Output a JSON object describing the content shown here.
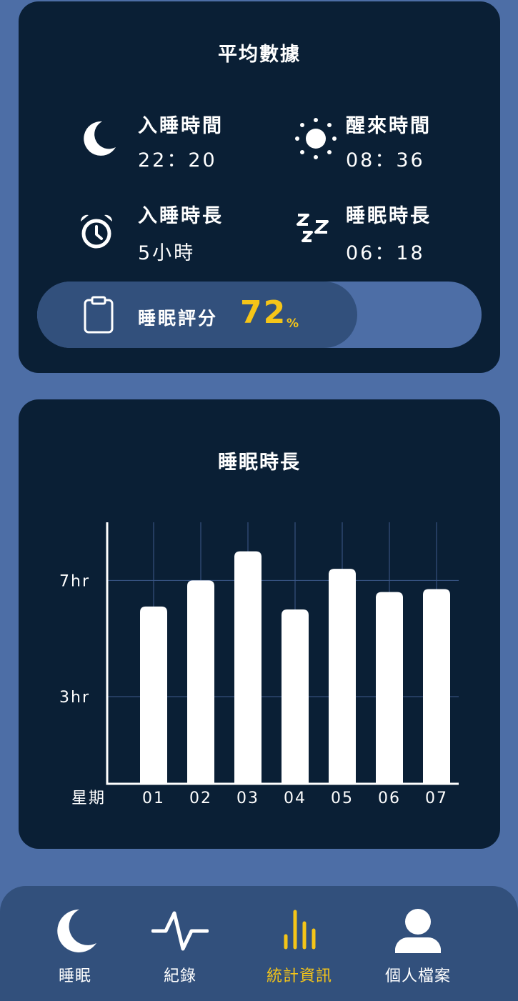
{
  "average": {
    "title": "平均數據",
    "sleep_time": {
      "label": "入睡時間",
      "value": "22：20",
      "icon": "moon-icon"
    },
    "wake_time": {
      "label": "醒來時間",
      "value": "08：36",
      "icon": "sun-icon"
    },
    "fall_asleep_duration": {
      "label": "入睡時長",
      "value": "5小時",
      "icon": "alarm-clock-icon"
    },
    "sleep_duration": {
      "label": "睡眠時長",
      "value": "06：18",
      "icon": "zzz-icon"
    },
    "score": {
      "label": "睡眠評分",
      "value": "72",
      "unit": "%",
      "percent": 72,
      "icon": "clipboard-icon"
    }
  },
  "chart_card": {
    "title": "睡眠時長"
  },
  "chart_data": {
    "type": "bar",
    "title": "睡眠時長",
    "xlabel": "星期",
    "ylabel": "",
    "categories": [
      "01",
      "02",
      "03",
      "04",
      "05",
      "06",
      "07"
    ],
    "values": [
      6.1,
      7.0,
      8.0,
      6.0,
      7.4,
      6.6,
      6.7
    ],
    "ytick_values": [
      3,
      7
    ],
    "ytick_labels": [
      "3hr",
      "7hr"
    ],
    "ylim": [
      0,
      9
    ],
    "grid": true,
    "bar_color": "#ffffff"
  },
  "colors": {
    "background": "#4d6ea6",
    "card": "#0a1f35",
    "accent": "#f5c518",
    "nav": "#32507c"
  },
  "nav": {
    "items": [
      {
        "label": "睡眠",
        "icon": "moon-icon",
        "active": false
      },
      {
        "label": "紀錄",
        "icon": "pulse-icon",
        "active": false
      },
      {
        "label": "統計資訊",
        "icon": "bar-chart-icon",
        "active": true
      },
      {
        "label": "個人檔案",
        "icon": "user-icon",
        "active": false
      }
    ]
  }
}
